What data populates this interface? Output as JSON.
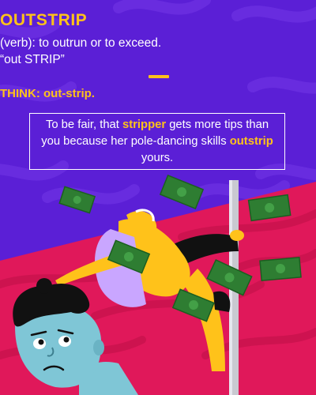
{
  "word": "OUTSTRIP",
  "definition_line1": "(verb): to outrun or to exceed.",
  "definition_line2": "“out STRIP”",
  "think": "THINK: out-strip.",
  "sentence": {
    "part1": "To be fair, that ",
    "highlight1": "stripper",
    "part2": " gets more tips than you because her pole-dancing skills ",
    "highlight2": "outstrip",
    "part3": " yours."
  },
  "colors": {
    "background_purple": "#5b1fd6",
    "stripe_purple": "#6a2ee0",
    "floor_red": "#e0185a",
    "accent_yellow": "#ffc21a",
    "money_green": "#2e7d32",
    "dancer_purple": "#c9a6ff",
    "man_skin": "#7fc6d6"
  },
  "icons": [
    "money-bill-icon",
    "pole-icon"
  ]
}
